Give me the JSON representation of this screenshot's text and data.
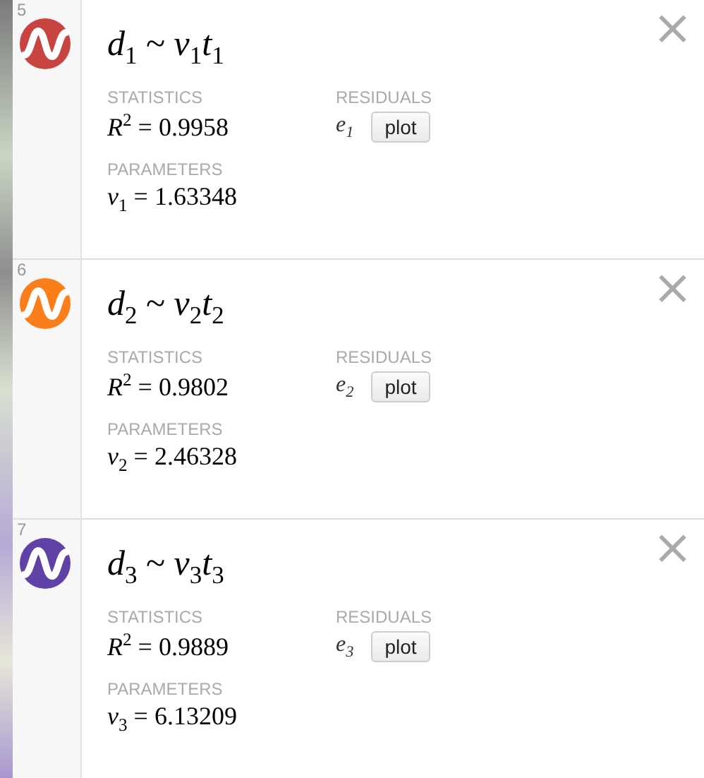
{
  "expressions": [
    {
      "number": "5",
      "color": "#c74440",
      "formula": "*d*$_{1}$ ~ *v*$_{1}$*t*$_{1}$",
      "statistics_label": "STATISTICS",
      "statistic": "*R*$^{2}$ = 0.9958",
      "residuals_label": "RESIDUALS",
      "residual_variable": "*e*$_{1}$",
      "plot_button": "plot",
      "parameters_label": "PARAMETERS",
      "parameter": "*v*$_{1}$ = 1.63348",
      "close": "×"
    },
    {
      "number": "6",
      "color": "#fa7e19",
      "formula": "*d*$_{2}$ ~ *v*$_{2}$*t*$_{2}$",
      "statistics_label": "STATISTICS",
      "statistic": "*R*$^{2}$ = 0.9802",
      "residuals_label": "RESIDUALS",
      "residual_variable": "*e*$_{2}$",
      "plot_button": "plot",
      "parameters_label": "PARAMETERS",
      "parameter": "*v*$_{2}$ = 2.46328",
      "close": "×"
    },
    {
      "number": "7",
      "color": "#6042a6",
      "formula": "*d*$_{3}$ ~ *v*$_{3}$*t*$_{3}$",
      "statistics_label": "STATISTICS",
      "statistic": "*R*$^{2}$ = 0.9889",
      "residuals_label": "RESIDUALS",
      "residual_variable": "*e*$_{3}$",
      "plot_button": "plot",
      "parameters_label": "PARAMETERS",
      "parameter": "*v*$_{3}$ = 6.13209",
      "close": "×"
    }
  ]
}
